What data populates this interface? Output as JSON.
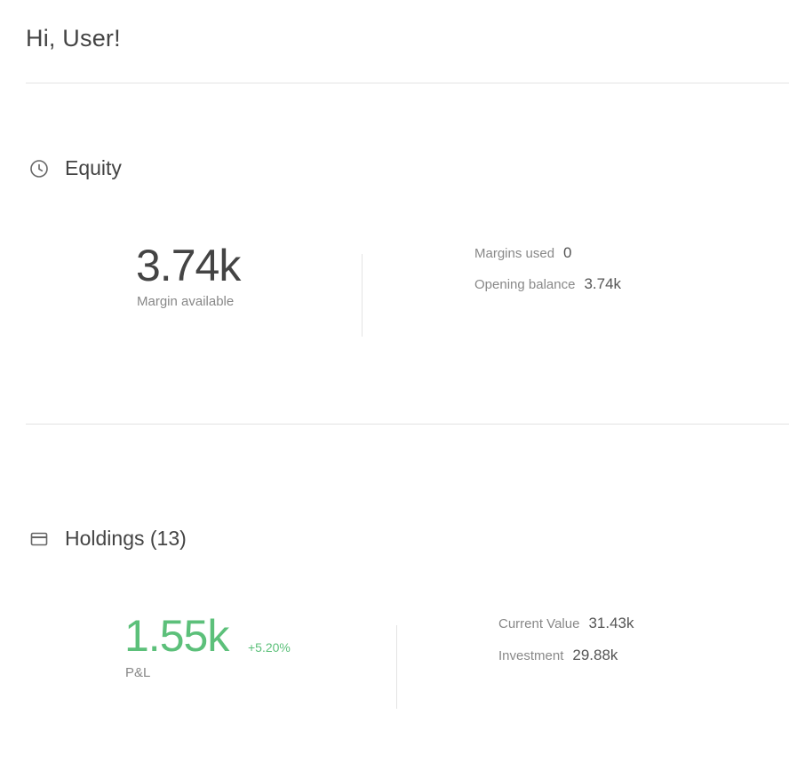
{
  "greeting": "Hi, User!",
  "equity": {
    "title": "Equity",
    "icon": "clock-icon",
    "margin_available_value": "3.74k",
    "margin_available_label": "Margin available",
    "stats": [
      {
        "label": "Margins used",
        "value": "0"
      },
      {
        "label": "Opening balance",
        "value": "3.74k"
      }
    ]
  },
  "holdings": {
    "title": "Holdings (13)",
    "icon": "card-icon",
    "pnl_value": "1.55k",
    "pnl_change": "+5.20%",
    "pnl_label": "P&L",
    "stats": [
      {
        "label": "Current Value",
        "value": "31.43k"
      },
      {
        "label": "Investment",
        "value": "29.88k"
      }
    ]
  },
  "colors": {
    "text": "#444444",
    "muted": "#888888",
    "positive": "#5cc07a",
    "divider": "#e3e3e3"
  }
}
